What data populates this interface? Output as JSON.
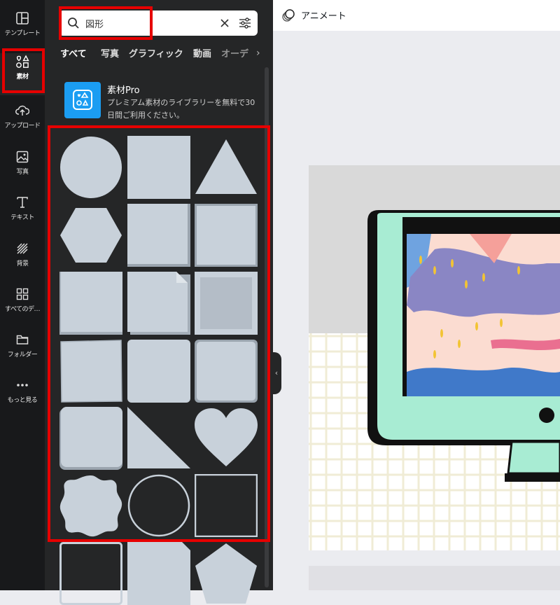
{
  "rail": {
    "items": [
      {
        "label": "テンプレート",
        "icon": "template-icon"
      },
      {
        "label": "素材",
        "icon": "elements-icon"
      },
      {
        "label": "アップロード",
        "icon": "upload-icon"
      },
      {
        "label": "写真",
        "icon": "photo-icon"
      },
      {
        "label": "テキスト",
        "icon": "text-icon"
      },
      {
        "label": "背景",
        "icon": "background-icon"
      },
      {
        "label": "すべてのデ…",
        "icon": "all-designs-icon"
      },
      {
        "label": "フォルダー",
        "icon": "folder-icon"
      },
      {
        "label": "もっと見る",
        "icon": "more-icon"
      }
    ]
  },
  "search": {
    "value": "図形"
  },
  "tabs": [
    "すべて",
    "写真",
    "グラフィック",
    "動画",
    "オーデ"
  ],
  "promo": {
    "title": "素材Pro",
    "description": "プレミアム素材のライブラリーを無料で30日間ご利用ください。"
  },
  "topbar": {
    "animate_label": "アニメート"
  },
  "colors": {
    "highlight": "#e60000",
    "accent": "#8b6ff3",
    "shape_fill": "#c8d1da",
    "rail_bg": "#18191b",
    "panel_bg": "#252627"
  }
}
